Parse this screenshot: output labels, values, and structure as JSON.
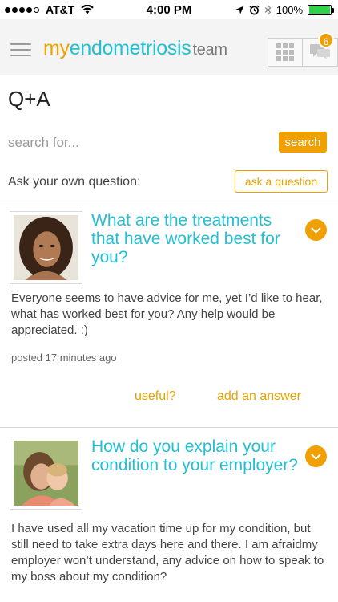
{
  "status_bar": {
    "carrier": "AT&T",
    "time": "4:00 PM",
    "battery": "100%",
    "battery_level": 1.0
  },
  "header": {
    "logo_my": "my",
    "logo_brand": "endometriosis",
    "logo_team": "team",
    "notification_count": "6"
  },
  "page": {
    "title": "Q+A"
  },
  "search": {
    "placeholder": "search for...",
    "button_label": "search"
  },
  "ask": {
    "label": "Ask your own question:",
    "button_label": "ask a question"
  },
  "questions": [
    {
      "title": "What are the treatments that have worked best for you?",
      "body": "Everyone seems to have advice for me, yet I’d like to hear, what has worked best for you? Any help would be appreciated. :)",
      "posted": "posted 17 minutes ago",
      "useful_label": "useful?",
      "answer_label": "add an answer"
    },
    {
      "title": "How do you explain your condition to your employer?",
      "body": "I have used all my vacation time up for my condition, but still need to take extra days here and there.  I am afraidmy employer won’t understand, any advice on how to speak to my boss about my condition?"
    }
  ],
  "colors": {
    "accent_orange": "#f0a000",
    "brand_teal": "#23bfd2",
    "battery_green": "#2fd34b"
  }
}
